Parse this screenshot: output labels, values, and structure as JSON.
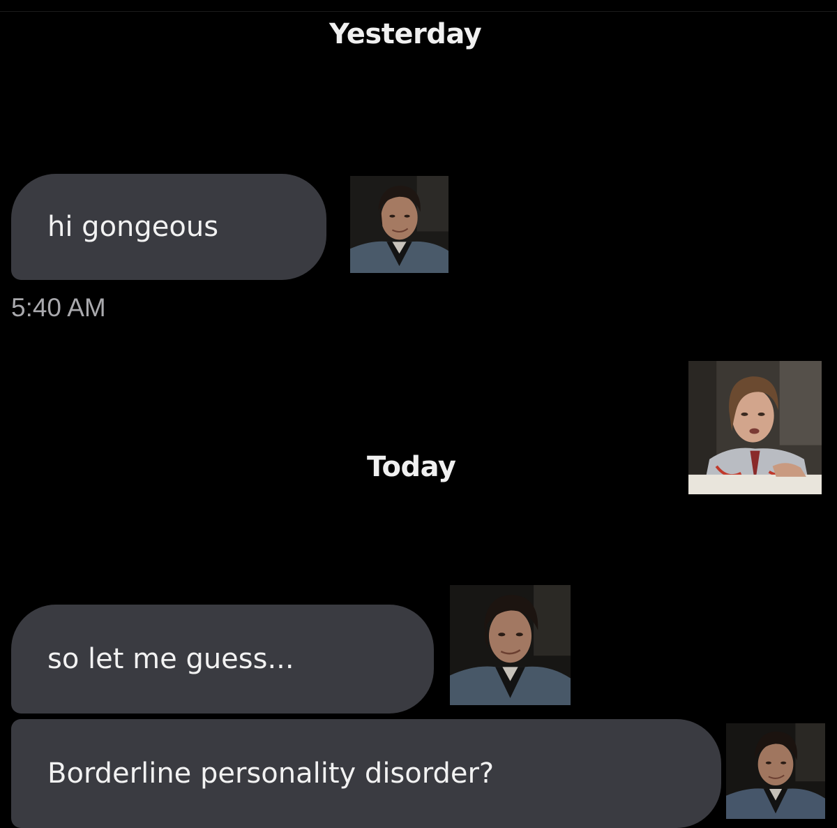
{
  "conversation": {
    "separators": {
      "yesterday": "Yesterday",
      "today": "Today"
    },
    "messages": [
      {
        "text": "hi gongeous",
        "time": "5:40 AM"
      },
      {
        "text": "so let me guess..."
      },
      {
        "text": "Borderline personality disorder?"
      }
    ]
  },
  "colors": {
    "background": "#000000",
    "bubble": "#3a3b41",
    "bubble_text": "#f2f2f2",
    "timestamp": "#a9a9ad"
  },
  "reaction_images": [
    {
      "icon": "man-in-denim-jacket-smirking-photo"
    },
    {
      "icon": "young-man-with-shirt-and-tie-photo"
    },
    {
      "icon": "man-in-denim-jacket-smirking-photo"
    },
    {
      "icon": "man-in-denim-jacket-smirking-photo"
    }
  ]
}
